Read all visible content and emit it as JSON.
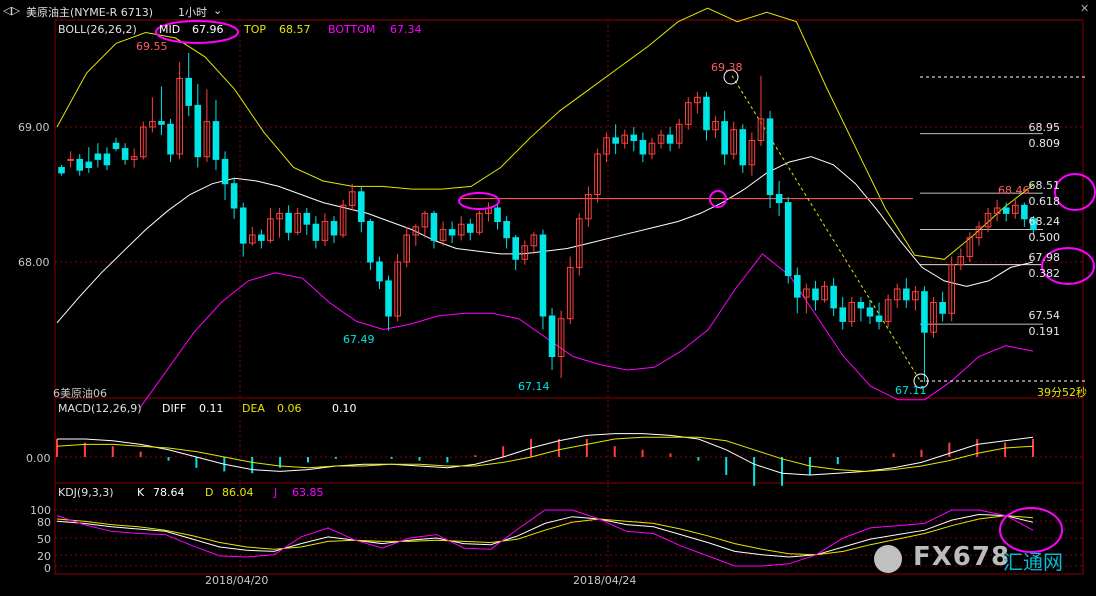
{
  "titlebar": {
    "instrument": "美原油主(NYME-R 6713)",
    "period": "1小时",
    "icons": [
      "back-forward-icon",
      "dropdown-arrow-icon",
      "close-icon"
    ]
  },
  "boll": {
    "label": "BOLL(26,26,2)",
    "mid_label": "MID",
    "mid_value": "67.96",
    "top_label": "TOP",
    "top_value": "68.57",
    "bottom_label": "BOTTOM",
    "bottom_value": "67.34"
  },
  "macd": {
    "label": "MACD(12,26,9)",
    "diff_label": "DIFF",
    "diff_value": "0.11",
    "dea_label": "DEA",
    "dea_value": "0.06",
    "macd_value": "0.10"
  },
  "kdj": {
    "label": "KDJ(9,3,3)",
    "k_label": "K",
    "k_value": "78.64",
    "d_label": "D",
    "d_value": "86.04",
    "j_label": "J",
    "j_value": "63.85"
  },
  "price_panel": {
    "y_ticks": [
      "69.00",
      "68.00"
    ],
    "sub_label": "6美原油06",
    "countdown": "39分52秒",
    "annotations": {
      "high1": "69.55",
      "low1": "67.49",
      "low2": "67.14",
      "high2": "69.38",
      "low3": "67.11",
      "recent_high": "68.46"
    }
  },
  "fibonacci": [
    {
      "price": "68.95",
      "ratio": "0.809"
    },
    {
      "price": "68.51",
      "ratio": "0.618"
    },
    {
      "price": "68.24",
      "ratio": "0.500"
    },
    {
      "price": "67.98",
      "ratio": "0.382"
    },
    {
      "price": "67.54",
      "ratio": "0.191"
    }
  ],
  "macd_panel": {
    "y_ticks": [
      "0.00"
    ]
  },
  "kdj_panel": {
    "y_ticks": [
      "100",
      "80",
      "50",
      "20",
      "0"
    ]
  },
  "x_axis": {
    "dates": [
      "2018/04/20",
      "2018/04/24"
    ]
  },
  "watermark": {
    "text": "FX678",
    "subtext": "汇通网"
  },
  "colors": {
    "up": "#ff4040",
    "down": "#00e5e5",
    "mid": "#ffffff",
    "top": "#e6e600",
    "bottom": "#ff00ff",
    "highlight": "#ff00ff",
    "grid": "#8b0000"
  },
  "chart_data": {
    "type": "candlestick",
    "title": "美原油主(NYME-R 6713) 1小时",
    "price_axis_ticks": [
      69.0,
      68.0
    ],
    "ylim": [
      66.9,
      69.85
    ],
    "candles": [
      [
        68.7,
        68.72,
        68.66,
        68.64
      ],
      [
        68.76,
        68.82,
        68.76,
        68.7
      ],
      [
        68.76,
        68.8,
        68.68,
        68.64
      ],
      [
        68.74,
        68.85,
        68.7,
        68.66
      ],
      [
        68.8,
        68.88,
        68.76,
        68.7
      ],
      [
        68.8,
        68.85,
        68.72,
        68.68
      ],
      [
        68.88,
        68.92,
        68.84,
        68.82
      ],
      [
        68.84,
        68.88,
        68.76,
        68.72
      ],
      [
        68.76,
        68.84,
        68.78,
        68.7
      ],
      [
        68.78,
        69.04,
        69.0,
        68.76
      ],
      [
        69.0,
        69.22,
        69.04,
        68.96
      ],
      [
        69.04,
        69.3,
        69.02,
        68.94
      ],
      [
        69.02,
        69.06,
        68.8,
        68.74
      ],
      [
        68.8,
        69.48,
        69.36,
        68.76
      ],
      [
        69.36,
        69.55,
        69.16,
        69.08
      ],
      [
        69.16,
        69.32,
        68.78,
        68.7
      ],
      [
        68.78,
        69.28,
        69.04,
        68.74
      ],
      [
        69.04,
        69.2,
        68.76,
        68.68
      ],
      [
        68.76,
        68.82,
        68.58,
        68.46
      ],
      [
        68.58,
        68.62,
        68.4,
        68.32
      ],
      [
        68.4,
        68.44,
        68.14,
        68.04
      ],
      [
        68.14,
        68.26,
        68.2,
        68.12
      ],
      [
        68.2,
        68.24,
        68.16,
        68.1
      ],
      [
        68.16,
        68.4,
        68.32,
        68.14
      ],
      [
        68.32,
        68.4,
        68.36,
        68.18
      ],
      [
        68.36,
        68.42,
        68.22,
        68.16
      ],
      [
        68.22,
        68.4,
        68.36,
        68.2
      ],
      [
        68.36,
        68.4,
        68.28,
        68.2
      ],
      [
        68.28,
        68.34,
        68.16,
        68.1
      ],
      [
        68.16,
        68.36,
        68.3,
        68.12
      ],
      [
        68.3,
        68.34,
        68.2,
        68.14
      ],
      [
        68.2,
        68.46,
        68.42,
        68.18
      ],
      [
        68.42,
        68.58,
        68.52,
        68.38
      ],
      [
        68.52,
        68.56,
        68.3,
        68.22
      ],
      [
        68.3,
        68.32,
        68.0,
        67.94
      ],
      [
        68.0,
        68.04,
        67.86,
        67.8
      ],
      [
        67.86,
        67.9,
        67.6,
        67.49
      ],
      [
        67.6,
        68.06,
        68.0,
        67.56
      ],
      [
        68.0,
        68.26,
        68.2,
        67.96
      ],
      [
        68.2,
        68.28,
        68.26,
        68.12
      ],
      [
        68.26,
        68.38,
        68.36,
        68.18
      ],
      [
        68.36,
        68.38,
        68.16,
        68.1
      ],
      [
        68.16,
        68.3,
        68.24,
        68.12
      ],
      [
        68.24,
        68.3,
        68.2,
        68.14
      ],
      [
        68.2,
        68.34,
        68.28,
        68.16
      ],
      [
        68.28,
        68.32,
        68.22,
        68.16
      ],
      [
        68.22,
        68.38,
        68.36,
        68.2
      ],
      [
        68.36,
        68.44,
        68.4,
        68.3
      ],
      [
        68.4,
        68.44,
        68.3,
        68.24
      ],
      [
        68.3,
        68.34,
        68.18,
        68.1
      ],
      [
        68.18,
        68.2,
        68.02,
        67.94
      ],
      [
        68.02,
        68.16,
        68.12,
        67.98
      ],
      [
        68.12,
        68.22,
        68.2,
        68.06
      ],
      [
        68.2,
        68.24,
        67.6,
        67.5
      ],
      [
        67.6,
        67.66,
        67.3,
        67.2
      ],
      [
        67.3,
        67.64,
        67.58,
        67.14
      ],
      [
        67.58,
        68.04,
        67.96,
        67.54
      ],
      [
        67.96,
        68.36,
        68.32,
        67.9
      ],
      [
        68.32,
        68.56,
        68.5,
        68.26
      ],
      [
        68.5,
        68.84,
        68.8,
        68.44
      ],
      [
        68.8,
        68.96,
        68.92,
        68.74
      ],
      [
        68.92,
        69.02,
        68.88,
        68.8
      ],
      [
        68.88,
        68.98,
        68.94,
        68.84
      ],
      [
        68.94,
        69.0,
        68.9,
        68.82
      ],
      [
        68.9,
        68.96,
        68.8,
        68.74
      ],
      [
        68.8,
        68.92,
        68.88,
        68.76
      ],
      [
        68.88,
        68.98,
        68.94,
        68.84
      ],
      [
        68.94,
        69.0,
        68.88,
        68.82
      ],
      [
        68.88,
        69.06,
        69.02,
        68.84
      ],
      [
        69.02,
        69.22,
        69.18,
        68.98
      ],
      [
        69.18,
        69.26,
        69.22,
        69.1
      ],
      [
        69.22,
        69.26,
        68.98,
        68.9
      ],
      [
        68.98,
        69.08,
        69.04,
        68.92
      ],
      [
        69.04,
        69.12,
        68.8,
        68.72
      ],
      [
        68.8,
        69.04,
        68.98,
        68.76
      ],
      [
        68.98,
        69.02,
        68.72,
        68.66
      ],
      [
        68.72,
        68.96,
        68.9,
        68.64
      ],
      [
        68.9,
        69.38,
        69.06,
        68.86
      ],
      [
        69.06,
        69.12,
        68.5,
        68.4
      ],
      [
        68.5,
        68.6,
        68.44,
        68.34
      ],
      [
        68.44,
        68.48,
        67.9,
        67.84
      ],
      [
        67.9,
        67.96,
        67.74,
        67.62
      ],
      [
        67.74,
        67.84,
        67.8,
        67.62
      ],
      [
        67.8,
        67.86,
        67.72,
        67.64
      ],
      [
        67.72,
        67.86,
        67.82,
        67.7
      ],
      [
        67.82,
        67.88,
        67.66,
        67.6
      ],
      [
        67.66,
        67.74,
        67.56,
        67.5
      ],
      [
        67.56,
        67.74,
        67.7,
        67.52
      ],
      [
        67.7,
        67.74,
        67.66,
        67.56
      ],
      [
        67.66,
        67.72,
        67.6,
        67.54
      ],
      [
        67.6,
        67.7,
        67.56,
        67.5
      ],
      [
        67.56,
        67.76,
        67.72,
        67.52
      ],
      [
        67.72,
        67.84,
        67.8,
        67.66
      ],
      [
        67.8,
        67.88,
        67.72,
        67.66
      ],
      [
        67.72,
        67.82,
        67.78,
        67.64
      ],
      [
        67.78,
        67.82,
        67.48,
        67.11
      ],
      [
        67.48,
        67.74,
        67.7,
        67.44
      ],
      [
        67.7,
        67.78,
        67.62,
        67.56
      ],
      [
        67.62,
        68.04,
        67.98,
        67.56
      ],
      [
        67.98,
        68.1,
        68.04,
        67.94
      ],
      [
        68.04,
        68.22,
        68.18,
        68.0
      ],
      [
        68.18,
        68.3,
        68.26,
        68.12
      ],
      [
        68.26,
        68.4,
        68.36,
        68.22
      ],
      [
        68.36,
        68.46,
        68.4,
        68.3
      ],
      [
        68.4,
        68.44,
        68.36,
        68.3
      ],
      [
        68.36,
        68.46,
        68.42,
        68.32
      ],
      [
        68.42,
        68.44,
        68.32,
        68.26
      ],
      [
        68.32,
        68.34,
        68.24,
        68.2
      ]
    ],
    "boll_mid": [
      67.55,
      67.74,
      67.92,
      68.08,
      68.24,
      68.38,
      68.5,
      68.58,
      68.62,
      68.6,
      68.56,
      68.5,
      68.44,
      68.4,
      68.36,
      68.3,
      68.24,
      68.16,
      68.1,
      68.08,
      68.06,
      68.06,
      68.08,
      68.1,
      68.14,
      68.18,
      68.22,
      68.26,
      68.3,
      68.36,
      68.44,
      68.54,
      68.66,
      68.74,
      68.78,
      68.72,
      68.58,
      68.38,
      68.16,
      67.96,
      67.86,
      67.82,
      67.86,
      67.96,
      68.0
    ],
    "boll_top": [
      69.0,
      69.4,
      69.62,
      69.7,
      69.66,
      69.52,
      69.28,
      68.96,
      68.7,
      68.6,
      68.56,
      68.56,
      68.54,
      68.54,
      68.56,
      68.7,
      68.92,
      69.12,
      69.28,
      69.44,
      69.6,
      69.78,
      69.88,
      69.78,
      69.85,
      69.78,
      69.3,
      68.85,
      68.4,
      68.05,
      68.02,
      68.2,
      68.4,
      68.57
    ],
    "boll_bottom": [
      66.92,
      67.2,
      67.48,
      67.7,
      67.86,
      67.92,
      67.88,
      67.7,
      67.56,
      67.5,
      67.54,
      67.6,
      67.62,
      67.62,
      67.58,
      67.44,
      67.3,
      67.24,
      67.2,
      67.22,
      67.34,
      67.5,
      67.8,
      68.06,
      67.9,
      67.6,
      67.3,
      67.08,
      66.98,
      66.98,
      67.12,
      67.3,
      67.38,
      67.34
    ],
    "resistance_level": 68.47,
    "trend_line": {
      "from": 69.38,
      "to": 67.11
    },
    "fibonacci_levels": [
      {
        "price": 68.95,
        "ratio": 0.809
      },
      {
        "price": 68.51,
        "ratio": 0.618
      },
      {
        "price": 68.24,
        "ratio": 0.5
      },
      {
        "price": 67.98,
        "ratio": 0.382
      },
      {
        "price": 67.54,
        "ratio": 0.191
      }
    ],
    "macd_diff": [
      0.1,
      0.1,
      0.09,
      0.07,
      0.04,
      0.0,
      -0.04,
      -0.07,
      -0.08,
      -0.07,
      -0.05,
      -0.04,
      -0.04,
      -0.05,
      -0.06,
      -0.04,
      0.0,
      0.05,
      0.09,
      0.12,
      0.13,
      0.13,
      0.12,
      0.1,
      0.04,
      -0.04,
      -0.09,
      -0.1,
      -0.09,
      -0.08,
      -0.06,
      -0.03,
      0.02,
      0.07,
      0.09,
      0.11
    ],
    "macd_dea": [
      0.06,
      0.07,
      0.07,
      0.06,
      0.05,
      0.03,
      0.0,
      -0.03,
      -0.05,
      -0.06,
      -0.05,
      -0.05,
      -0.04,
      -0.04,
      -0.05,
      -0.05,
      -0.03,
      0.0,
      0.04,
      0.07,
      0.1,
      0.11,
      0.11,
      0.11,
      0.09,
      0.04,
      -0.01,
      -0.05,
      -0.07,
      -0.08,
      -0.07,
      -0.05,
      -0.02,
      0.02,
      0.05,
      0.06
    ],
    "macd_hist": [
      0.1,
      0.08,
      0.06,
      0.03,
      -0.02,
      -0.06,
      -0.08,
      -0.09,
      -0.06,
      -0.03,
      -0.01,
      0.0,
      -0.01,
      -0.02,
      -0.03,
      0.01,
      0.06,
      0.1,
      0.1,
      0.1,
      0.06,
      0.04,
      0.02,
      -0.02,
      -0.1,
      -0.16,
      -0.16,
      -0.1,
      -0.04,
      0.0,
      0.02,
      0.04,
      0.08,
      0.1,
      0.08,
      0.1
    ],
    "kdj_k": [
      80,
      76,
      70,
      66,
      62,
      48,
      34,
      28,
      26,
      40,
      52,
      46,
      40,
      46,
      50,
      40,
      38,
      54,
      76,
      88,
      84,
      74,
      70,
      56,
      42,
      26,
      20,
      16,
      20,
      34,
      48,
      56,
      64,
      82,
      92,
      90,
      78
    ],
    "kdj_d": [
      84,
      80,
      74,
      70,
      64,
      54,
      42,
      34,
      30,
      34,
      44,
      46,
      44,
      44,
      46,
      44,
      42,
      48,
      64,
      78,
      84,
      80,
      76,
      66,
      54,
      40,
      30,
      22,
      20,
      26,
      38,
      48,
      58,
      72,
      84,
      90,
      86
    ],
    "kdj_j": [
      90,
      74,
      62,
      58,
      56,
      36,
      18,
      16,
      20,
      52,
      68,
      46,
      32,
      50,
      56,
      32,
      30,
      66,
      100,
      100,
      84,
      62,
      58,
      36,
      18,
      0,
      0,
      4,
      20,
      50,
      68,
      72,
      76,
      100,
      100,
      90,
      64
    ]
  }
}
